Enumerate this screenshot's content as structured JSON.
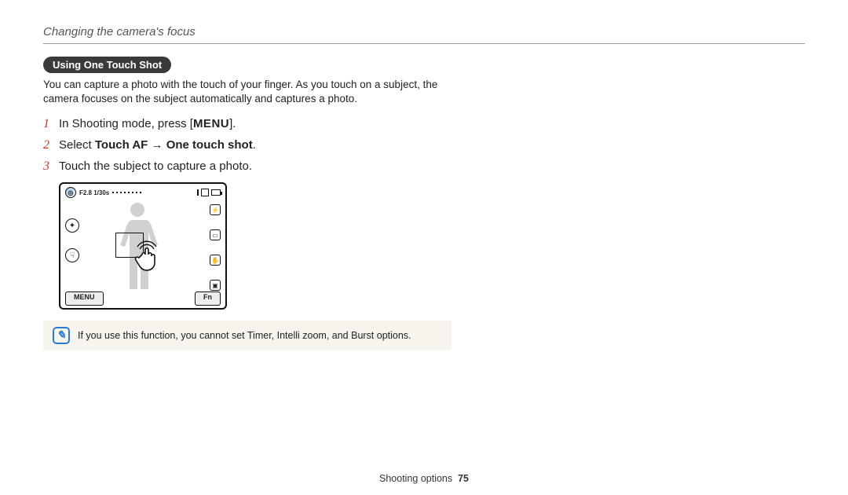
{
  "header": "Changing the camera's focus",
  "section_pill": "Using One Touch Shot",
  "intro": "You can capture a photo with the touch of your finger. As you touch on a subject, the camera focuses on the subject automatically and captures a photo.",
  "steps": {
    "s1_pre": "In Shooting mode, press [",
    "s1_menu": "MENU",
    "s1_post": "].",
    "s2_pre": "Select ",
    "s2_b1": "Touch AF",
    "s2_arrow": " → ",
    "s2_b2": "One touch shot",
    "s2_post": ".",
    "s3": "Touch the subject to capture a photo."
  },
  "camera": {
    "aperture_shutter": "F2.8 1/30s",
    "menu_btn": "MENU",
    "fn_btn": "Fn"
  },
  "note": "If you use this function, you cannot set Timer, Intelli zoom, and Burst options.",
  "footer_label": "Shooting options",
  "footer_page": "75"
}
